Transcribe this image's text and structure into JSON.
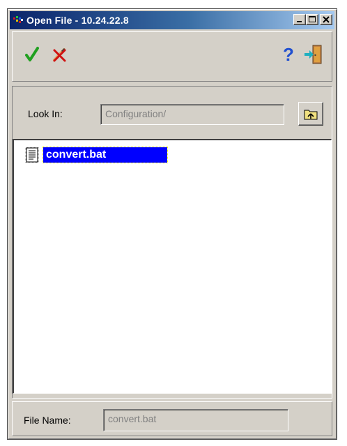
{
  "window": {
    "title": "Open File - 10.24.22.8"
  },
  "toolbar": {
    "ok_icon": "checkmark-icon",
    "cancel_icon": "cancel-pencil-icon",
    "help_icon": "question-mark-icon",
    "exit_icon": "exit-door-icon",
    "ok_color": "#20a020",
    "help_color": "#1f4fd0"
  },
  "look_in": {
    "label": "Look In:",
    "value": "Configuration/"
  },
  "file_list": {
    "items": [
      {
        "name": "convert.bat",
        "selected": true,
        "icon": "text-file-icon"
      }
    ],
    "selection_color": "#0000ff"
  },
  "file_name": {
    "label": "File Name:",
    "value": "convert.bat"
  }
}
